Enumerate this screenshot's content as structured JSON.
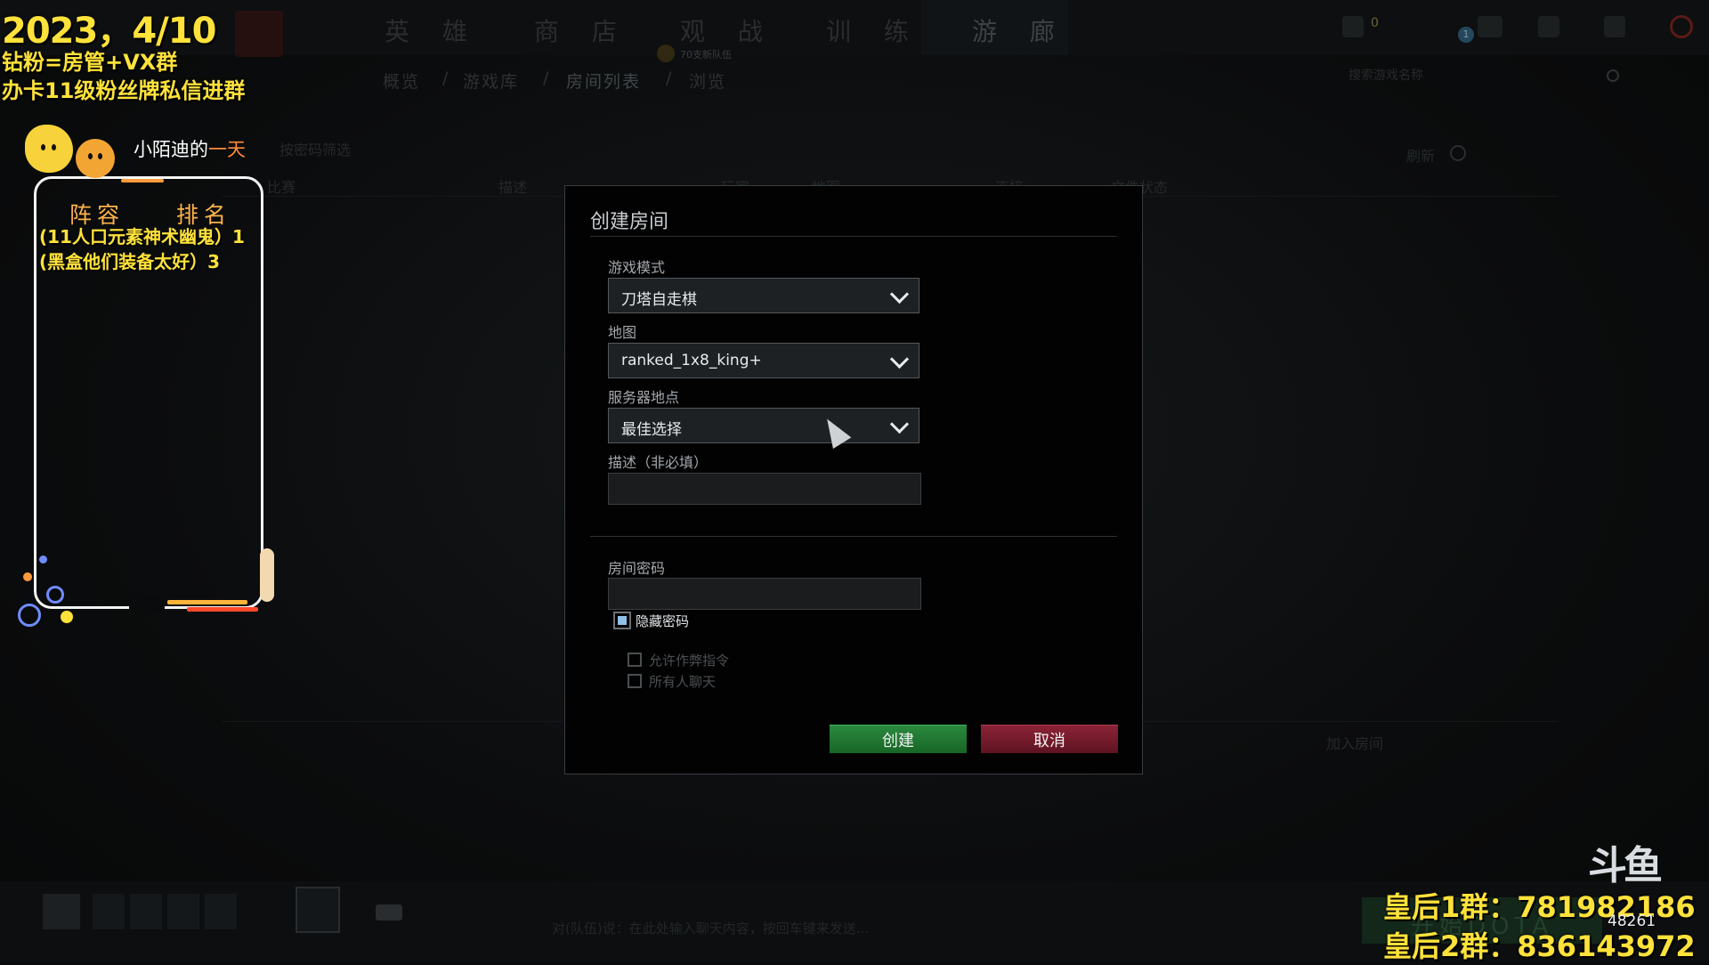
{
  "app": {
    "main_tabs": [
      "英 雄",
      "商 店",
      "观 战",
      "训 练",
      "游 廊"
    ],
    "active_tab": "游 廊",
    "team_label": "70支新队伍",
    "coin_count": "0",
    "notify_count": "1",
    "subnav": [
      "概览",
      "/",
      "游戏库",
      "/",
      "房间列表",
      "/",
      "浏览"
    ],
    "search_placeholder": "搜索游戏名称",
    "filter_label": "按密码筛选",
    "refresh_label": "刷新",
    "columns": [
      "比赛",
      "描述",
      "玩家",
      "地图",
      "连接",
      "文件状态"
    ],
    "join_room": "加入房间",
    "chat_prompt": "对(队伍)说：在此处输入聊天内容，按回车键来发送...",
    "play_label": "开始DOTA"
  },
  "dialog": {
    "title": "创建房间",
    "game_mode_label": "游戏模式",
    "game_mode_value": "刀塔自走棋",
    "map_label": "地图",
    "map_value": "ranked_1x8_king+",
    "server_label": "服务器地点",
    "server_value": "最佳选择",
    "desc_label": "描述（非必填）",
    "password_label": "房间密码",
    "hide_password_label": "隐藏密码",
    "allow_cheats_label": "允许作弊指令",
    "all_chat_label": "所有人聊天",
    "create_label": "创建",
    "cancel_label": "取消"
  },
  "overlay": {
    "date": "2023，4/10",
    "line1": "钻粉=房管+VX群",
    "line2": "办卡11级粉丝牌私信进群",
    "deco_title_a": "小陌迪的",
    "deco_title_b": "一天",
    "col_lineup": "阵容",
    "col_rank": "排名",
    "row1": "(11人口元素神术幽鬼）1",
    "row2": "(黑盒他们装备太好）3",
    "queen1": "皇后1群：781982186",
    "queen2": "皇后2群：836143972",
    "watermark": "斗鱼",
    "room_number": "48261"
  },
  "colors": {
    "accent_yellow": "#ffe23a",
    "create_green": "#1f7a33",
    "cancel_red": "#7a1a2e",
    "dialog_bg": "#020202"
  }
}
